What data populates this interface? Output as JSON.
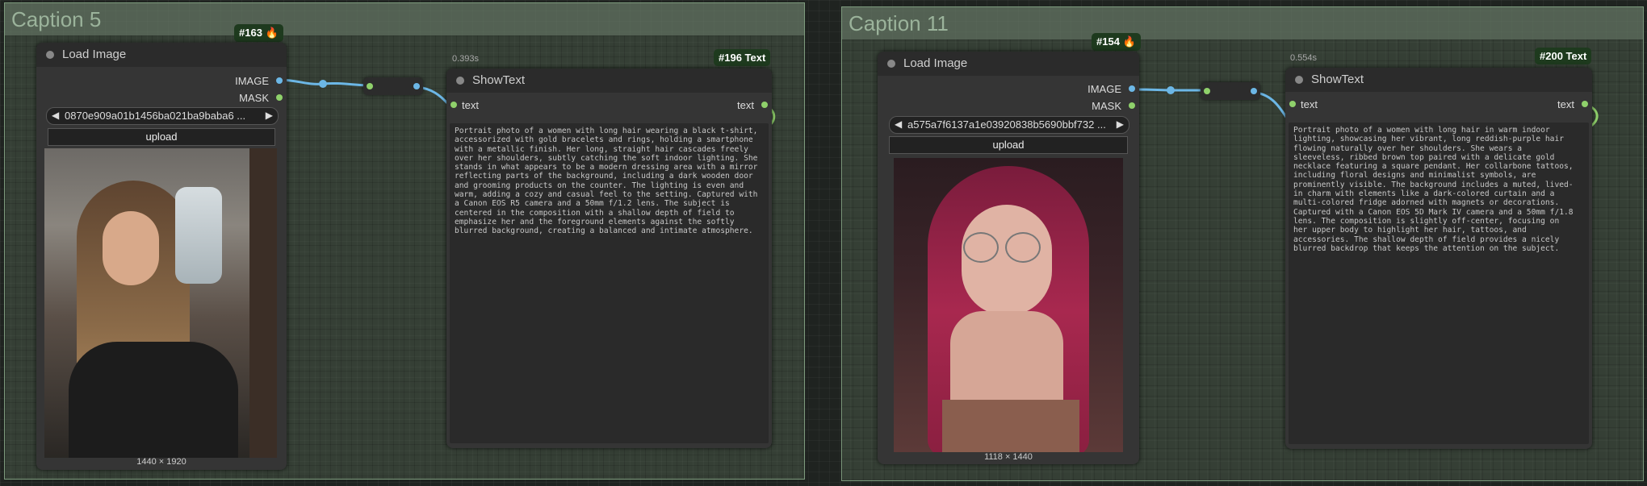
{
  "groups": [
    {
      "title": "Caption 5"
    },
    {
      "title": "Caption 11"
    }
  ],
  "load_image_nodes": [
    {
      "badge": "#163 🔥",
      "title": "Load Image",
      "outputs": [
        "IMAGE",
        "MASK"
      ],
      "file": "0870e909a01b1456ba021ba9baba6 ...",
      "upload_label": "upload",
      "dims": "1440 × 1920"
    },
    {
      "badge": "#154 🔥",
      "title": "Load Image",
      "outputs": [
        "IMAGE",
        "MASK"
      ],
      "file": "a575a7f6137a1e03920838b5690bbf732 ...",
      "upload_label": "upload",
      "dims": "1118 × 1440"
    }
  ],
  "show_text_nodes": [
    {
      "time": "0.393s",
      "badge": "#196 Text",
      "title": "ShowText",
      "input": "text",
      "output": "text",
      "text": "Portrait photo of a women with long hair wearing a black t-shirt,\naccessorized with gold bracelets and rings, holding a smartphone\nwith a metallic finish. Her long, straight hair cascades freely\nover her shoulders, subtly catching the soft indoor lighting. She\nstands in what appears to be a modern dressing area with a mirror\nreflecting parts of the background, including a dark wooden door\nand grooming products on the counter. The lighting is even and\nwarm, adding a cozy and casual feel to the setting. Captured with\na Canon EOS R5 camera and a 50mm f/1.2 lens. The subject is\ncentered in the composition with a shallow depth of field to\nemphasize her and the foreground elements against the softly\nblurred background, creating a balanced and intimate atmosphere."
    },
    {
      "time": "0.554s",
      "badge": "#200 Text",
      "title": "ShowText",
      "input": "text",
      "output": "text",
      "text": "Portrait photo of a women with long hair in warm indoor\nlighting, showcasing her vibrant, long reddish-purple hair\nflowing naturally over her shoulders. She wears a\nsleeveless, ribbed brown top paired with a delicate gold\nnecklace featuring a square pendant. Her collarbone tattoos,\nincluding floral designs and minimalist symbols, are\nprominently visible. The background includes a muted, lived-\nin charm with elements like a dark-colored curtain and a\nmulti-colored fridge adorned with magnets or decorations.\nCaptured with a Canon EOS 5D Mark IV camera and a 50mm f/1.8\nlens. The composition is slightly off-center, focusing on\nher upper body to highlight her hair, tattoos, and\naccessories. The shallow depth of field provides a nicely\nblurred backdrop that keeps the attention on the subject."
    }
  ],
  "colors": {
    "image_wire": "#6cb7e6",
    "text_wire": "#8fd16b",
    "badge_bg": "#1e3a1e",
    "group_title": "#9bb39b"
  }
}
